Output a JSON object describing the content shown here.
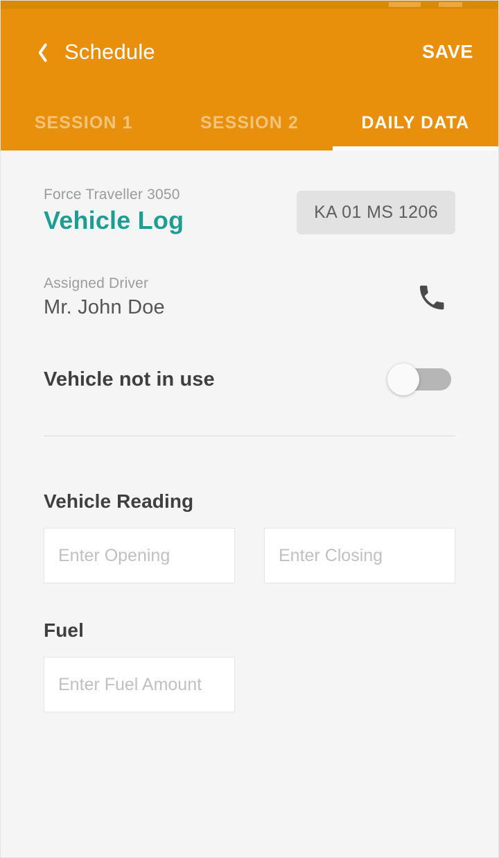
{
  "header": {
    "back_icon": "chevron-left-icon",
    "title": "Schedule",
    "save_label": "SAVE",
    "accent_color": "#E8900C",
    "status_bar_color": "#D98908"
  },
  "tabs": {
    "items": [
      {
        "label": "SESSION 1",
        "active": false
      },
      {
        "label": "SESSION 2",
        "active": false
      },
      {
        "label": "DAILY DATA",
        "active": true
      }
    ],
    "active_index": 2,
    "indicator_color": "#FFFFFF"
  },
  "vehicle": {
    "model": "Force Traveller 3050",
    "title": "Vehicle Log",
    "title_color": "#1F9D93",
    "plate_number": "KA 01 MS 1206",
    "plate_background": "#E2E2E2"
  },
  "driver": {
    "label": "Assigned Driver",
    "name": "Mr. John Doe",
    "call_icon": "phone-icon"
  },
  "not_in_use": {
    "label": "Vehicle not in use",
    "enabled": false,
    "track_color": "#B6B6B6",
    "knob_color": "#FAFAFA"
  },
  "vehicle_reading": {
    "section_title": "Vehicle Reading",
    "opening": {
      "value": "",
      "placeholder": "Enter Opening"
    },
    "closing": {
      "value": "",
      "placeholder": "Enter Closing"
    }
  },
  "fuel": {
    "section_title": "Fuel",
    "amount": {
      "value": "",
      "placeholder": "Enter Fuel Amount"
    }
  },
  "page": {
    "background_color": "#F5F5F5"
  }
}
